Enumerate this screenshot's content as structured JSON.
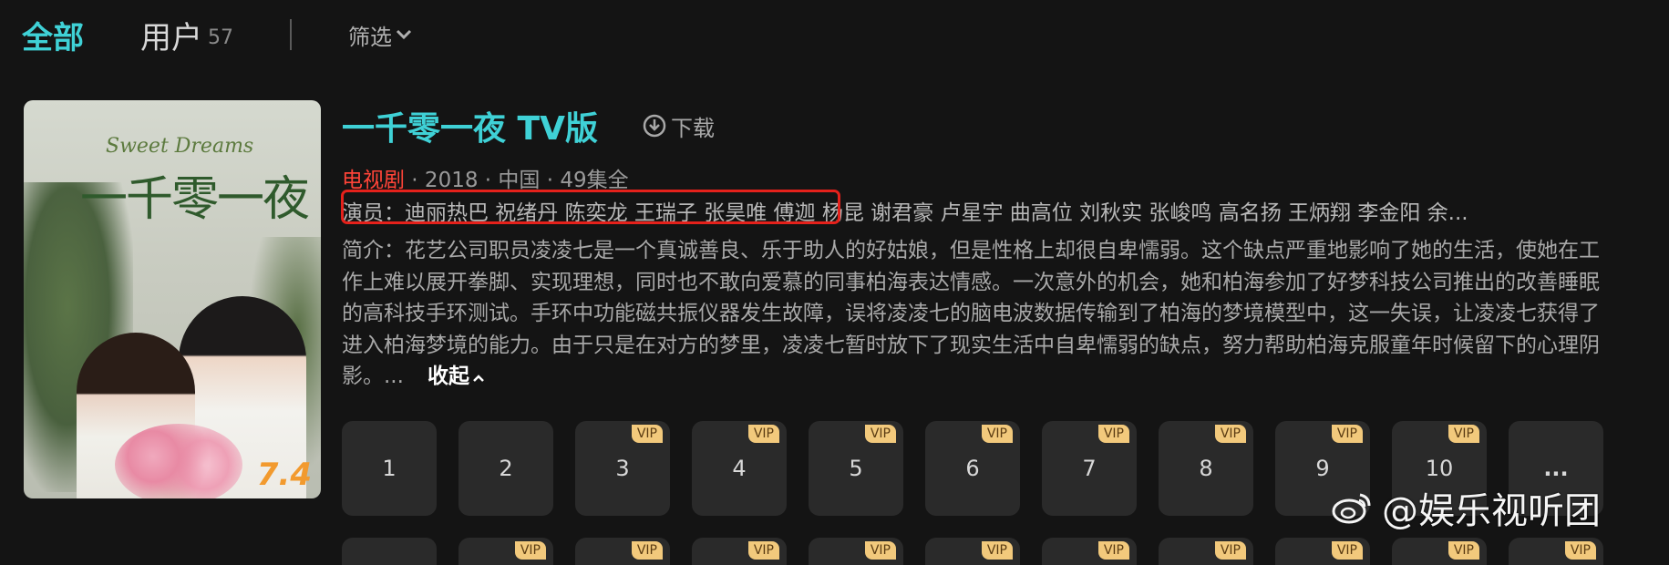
{
  "tabs": {
    "all_label": "全部",
    "users_label": "用户",
    "users_count": "57",
    "filter_label": "筛选"
  },
  "show": {
    "poster_sweet": "Sweet Dreams",
    "poster_title": "一千零一夜",
    "poster_score": "7.4",
    "title": "一千零一夜 TV版",
    "download_label": "下载",
    "genre": "电视剧",
    "meta": " · 2018 · 中国 · 49集全",
    "cast": "演员：迪丽热巴 祝绪丹 陈奕龙 王瑞子 张昊唯 傅迦 杨昆 谢君豪 卢星宇 曲高位 刘秋实 张峻鸣 高名扬 王炳翔 李金阳 余...",
    "description": "简介：花艺公司职员凌凌七是一个真诚善良、乐于助人的好姑娘，但是性格上却很自卑懦弱。这个缺点严重地影响了她的生活，使她在工作上难以展开拳脚、实现理想，同时也不敢向爱慕的同事柏海表达情感。一次意外的机会，她和柏海参加了好梦科技公司推出的改善睡眠的高科技手环测试。手环中功能磁共振仪器发生故障，误将凌凌七的脑电波数据传输到了柏海的梦境模型中，这一失误，让凌凌七获得了进入柏海梦境的能力。由于只是在对方的梦里，凌凌七暂时放下了现实生活中自卑懦弱的缺点，努力帮助柏海克服童年时候留下的心理阴影。...",
    "collapse_label": "收起"
  },
  "episodes": [
    {
      "label": "1",
      "vip": ""
    },
    {
      "label": "2",
      "vip": ""
    },
    {
      "label": "3",
      "vip": "VIP"
    },
    {
      "label": "4",
      "vip": "VIP"
    },
    {
      "label": "5",
      "vip": "VIP"
    },
    {
      "label": "6",
      "vip": "VIP"
    },
    {
      "label": "7",
      "vip": "VIP"
    },
    {
      "label": "8",
      "vip": "VIP"
    },
    {
      "label": "9",
      "vip": "VIP"
    },
    {
      "label": "10",
      "vip": "VIP"
    },
    {
      "label": "...",
      "vip": ""
    }
  ],
  "row2_vip": "VIP",
  "watermark": "@娱乐视听团",
  "colors": {
    "accent": "#3fd1d6",
    "genre": "#ff4438",
    "highlight_box": "#e5211b",
    "vip_badge": "#f2c97c"
  }
}
